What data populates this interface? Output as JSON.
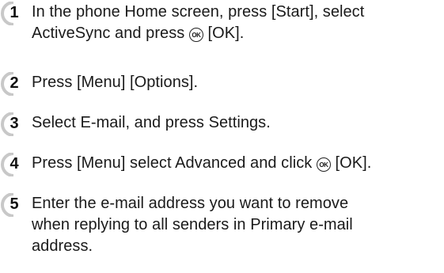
{
  "steps": [
    {
      "number": "1",
      "line1": "In the phone Home screen, press [Start], select",
      "line2_before_icon": "ActiveSync and press ",
      "line2_after_icon": " [OK]."
    },
    {
      "number": "2",
      "text": "Press [Menu] [Options]."
    },
    {
      "number": "3",
      "text": "Select E-mail, and press Settings."
    },
    {
      "number": "4",
      "text_before_icon": "Press [Menu] select Advanced and click ",
      "text_after_icon": " [OK]."
    },
    {
      "number": "5",
      "line1": "Enter the e-mail address you want to remove",
      "line2": "when replying to all senders in Primary e-mail",
      "line3": "address."
    }
  ],
  "icons": {
    "ok_key_glyph": "OK",
    "badge_color": "#c8c8c8"
  }
}
